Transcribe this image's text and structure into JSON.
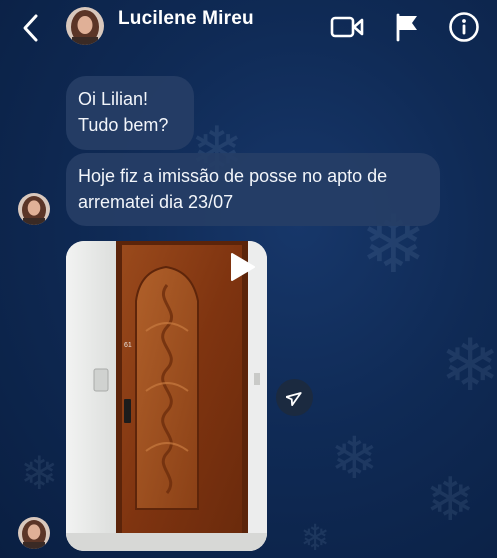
{
  "header": {
    "contact_name": "Lucilene Mireu",
    "back_icon": "chevron-left-icon",
    "icons": [
      "video-call-icon",
      "flag-icon",
      "info-icon"
    ]
  },
  "messages": [
    {
      "lines": [
        "Oi Lilian!",
        "Tudo bem?"
      ]
    },
    {
      "lines": [
        "Hoje fiz a imissão de posse no apto de",
        "arrematei dia 23/07"
      ]
    }
  ],
  "media": {
    "type": "video",
    "door_number": "61",
    "play_icon": "play-icon",
    "share_icon": "send-icon"
  },
  "colors": {
    "background": "#0f2a55",
    "bubble": "#263e66",
    "door": "#8a3a14",
    "wall": "#e9ebea"
  }
}
